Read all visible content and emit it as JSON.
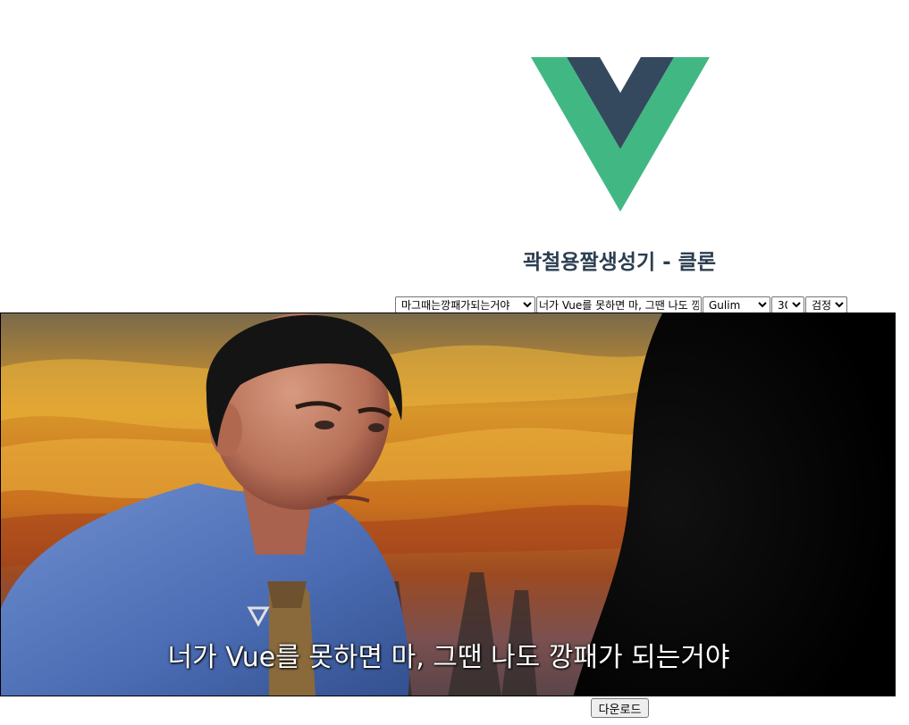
{
  "header": {
    "title": "곽철용짤생성기 - 클론"
  },
  "logo": {
    "primary_color": "#41b883",
    "secondary_color": "#34495e"
  },
  "controls": {
    "template_select": {
      "selected": "마그때는깡패가되는거야"
    },
    "subtitle_input": {
      "value": "너가 Vue를 못하면 마, 그땐 나도 깡패가 되는거야"
    },
    "font_select": {
      "selected": "Gulim"
    },
    "size_select": {
      "selected": "30"
    },
    "color_select": {
      "selected": "검정"
    }
  },
  "meme": {
    "subtitle": "너가 Vue를 못하면 마, 그땐 나도 깡패가 되는거야"
  },
  "download_label": "다운로드"
}
